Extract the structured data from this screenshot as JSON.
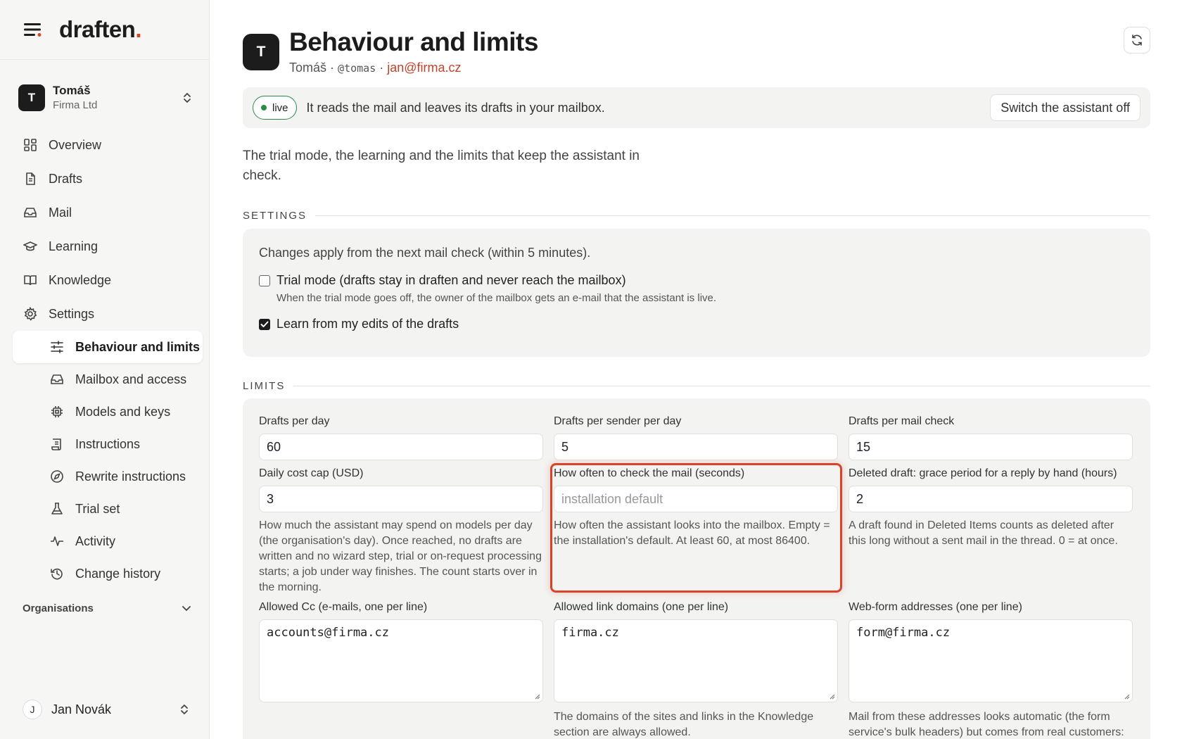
{
  "app": {
    "logo_text": "draften",
    "logo_dot": ".",
    "accent_color": "#d24a2a"
  },
  "sidebar": {
    "account": {
      "initial": "T",
      "name": "Tomáš",
      "org": "Firma Ltd"
    },
    "nav": [
      {
        "label": "Overview",
        "icon": "grid-icon"
      },
      {
        "label": "Drafts",
        "icon": "document-icon"
      },
      {
        "label": "Mail",
        "icon": "inbox-icon"
      },
      {
        "label": "Learning",
        "icon": "graduation-cap-icon"
      },
      {
        "label": "Knowledge",
        "icon": "book-icon"
      },
      {
        "label": "Settings",
        "icon": "gear-icon"
      }
    ],
    "settings_sub": [
      {
        "label": "Behaviour and limits",
        "icon": "sliders-icon",
        "active": true
      },
      {
        "label": "Mailbox and access",
        "icon": "inbox-icon"
      },
      {
        "label": "Models and keys",
        "icon": "chip-icon"
      },
      {
        "label": "Instructions",
        "icon": "scroll-icon"
      },
      {
        "label": "Rewrite instructions",
        "icon": "compass-icon"
      },
      {
        "label": "Trial set",
        "icon": "flask-icon"
      },
      {
        "label": "Activity",
        "icon": "pulse-icon"
      },
      {
        "label": "Change history",
        "icon": "history-icon"
      }
    ],
    "organisations_label": "Organisations",
    "user": {
      "initial": "J",
      "name": "Jan Novák"
    }
  },
  "header": {
    "avatar_initial": "T",
    "title": "Behaviour and limits",
    "user_name": "Tomáš",
    "sep1": "·",
    "handle": "@tomas",
    "sep2": "·",
    "email": "jan@firma.cz"
  },
  "status": {
    "pill": "live",
    "text": "It reads the mail and leaves its drafts in your mailbox.",
    "switch_label": "Switch the assistant off"
  },
  "intro": "The trial mode, the learning and the limits that keep the assistant in check.",
  "settings": {
    "heading": "SETTINGS",
    "note": "Changes apply from the next mail check (within 5 minutes).",
    "trial": {
      "checked": false,
      "label": "Trial mode (drafts stay in draften and never reach the mailbox)",
      "help": "When the trial mode goes off, the owner of the mailbox gets an e-mail that the assistant is live."
    },
    "learn": {
      "checked": true,
      "label": "Learn from my edits of the drafts"
    }
  },
  "limits": {
    "heading": "LIMITS",
    "drafts_per_day": {
      "label": "Drafts per day",
      "value": "60"
    },
    "drafts_per_sender": {
      "label": "Drafts per sender per day",
      "value": "5"
    },
    "drafts_per_check": {
      "label": "Drafts per mail check",
      "value": "15"
    },
    "daily_cost": {
      "label": "Daily cost cap (USD)",
      "value": "3",
      "help": "How much the assistant may spend on models per day (the organisation's day). Once reached, no drafts are written and no wizard step, trial or on-request processing starts; a job under way finishes. The count starts over in the morning."
    },
    "check_interval": {
      "label": "How often to check the mail (seconds)",
      "placeholder": "installation default",
      "help": "How often the assistant looks into the mailbox. Empty = the installation's default. At least 60, at most 86400."
    },
    "grace_period": {
      "label": "Deleted draft: grace period for a reply by hand (hours)",
      "value": "2",
      "help": "A draft found in Deleted Items counts as deleted after this long without a sent mail in the thread. 0 = at once."
    },
    "allowed_cc": {
      "label": "Allowed Cc (e-mails, one per line)",
      "value": "accounts@firma.cz"
    },
    "allowed_domains": {
      "label": "Allowed link domains (one per line)",
      "value": "firma.cz",
      "help": "The domains of the sites and links in the Knowledge section are always allowed."
    },
    "web_form": {
      "label": "Web-form addresses (one per line)",
      "value": "form@firma.cz",
      "help": "Mail from these addresses looks automatic (the form service's bulk headers) but comes from real customers:"
    }
  }
}
